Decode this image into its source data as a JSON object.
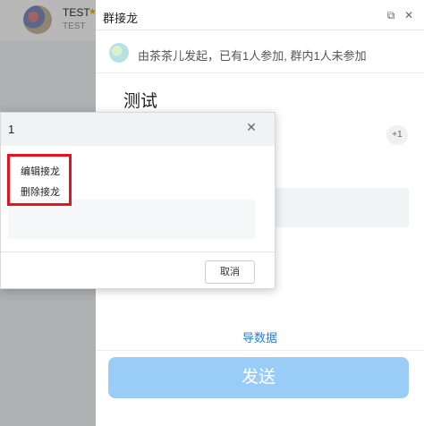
{
  "left": {
    "name": "TEST",
    "sub": "TEST"
  },
  "main": {
    "title": "群接龙",
    "initiator_text": "由茶茶儿发起，已有1人参加, 群内1人未参加",
    "topic_title": "测试",
    "participant_count": "+1",
    "export_label": "导数据",
    "send_label": "发送",
    "send_color": "#99cdf7"
  },
  "dialog": {
    "title": "1",
    "menu": {
      "edit_label": "编辑接龙",
      "delete_label": "删除接龙"
    },
    "cancel_label": "取消",
    "highlight_color": "#e8121c"
  },
  "icons": {
    "restore": "restore-window-icon",
    "close": "close-icon",
    "star": "star-icon"
  }
}
